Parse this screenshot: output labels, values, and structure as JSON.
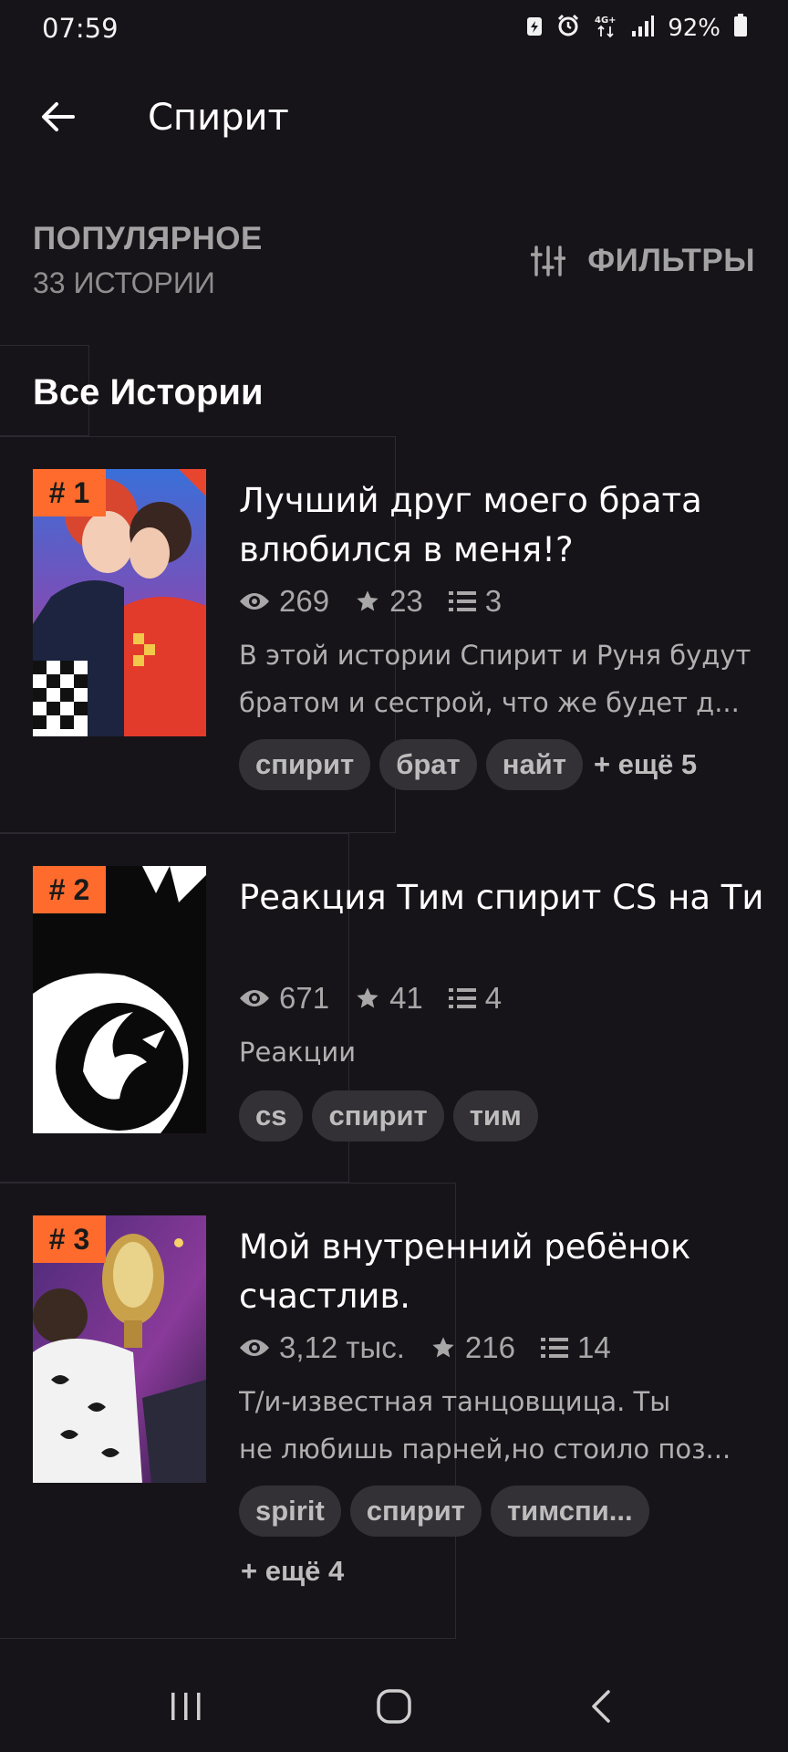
{
  "status_bar": {
    "time": "07:59",
    "battery": "92%",
    "network": "4G+"
  },
  "app_bar": {
    "title": "Спирит",
    "back_icon": "arrow-left-icon"
  },
  "section": {
    "sort_label": "ПОПУЛЯРНОЕ",
    "count_label": "33 ИСТОРИИ",
    "filter_label": "ФИЛЬТРЫ",
    "filter_icon": "sliders-icon"
  },
  "list_heading": "Все Истории",
  "stories": [
    {
      "rank": "# 1",
      "title": "Лучший друг моего брата влюбился в меня!?",
      "views": "269",
      "stars": "23",
      "parts": "3",
      "description": "В этой истории Спирит и Руня будут",
      "description_2": "братом и сестрой, что же будет д...",
      "tags": [
        "спирит",
        "брат",
        "найт"
      ],
      "more": "+ ещё 5"
    },
    {
      "rank": "# 2",
      "title": "Реакция Тим спирит CS на Ти",
      "views": "671",
      "stars": "41",
      "parts": "4",
      "description": "Реакции",
      "tags": [
        "cs",
        "спирит",
        "тим"
      ]
    },
    {
      "rank": "# 3",
      "title": "Мой внутренний ребёнок счастлив.",
      "views": "3,12 тыс.",
      "stars": "216",
      "parts": "14",
      "description": "Т/и-известная танцовщица. Ты",
      "description_2": "не любишь парней,но стоило поз...",
      "tags": [
        "spirit",
        "спирит",
        "тимспи..."
      ],
      "more": "+ ещё 4"
    }
  ],
  "colors": {
    "background": "#161419",
    "accent": "#ff6b2c",
    "chip": "#333136",
    "muted_text": "#a8a8a8"
  },
  "nav": {
    "recents_icon": "recents-icon",
    "home_icon": "home-icon",
    "back_icon": "back-chevron-icon"
  }
}
